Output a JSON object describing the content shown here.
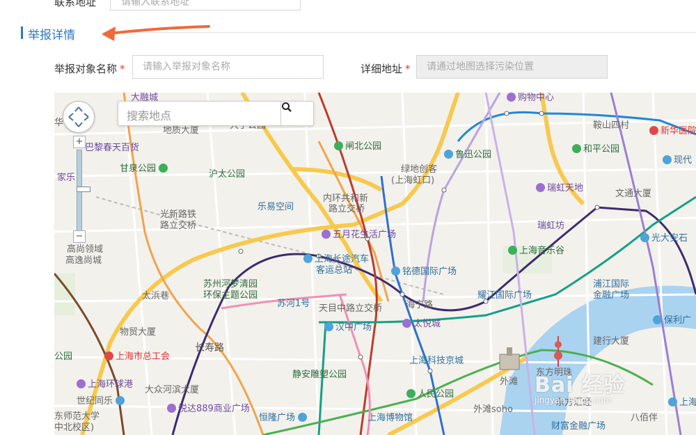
{
  "top_field": {
    "label": "联系地址",
    "placeholder": "请输入联系地址"
  },
  "section": {
    "title": "举报详情"
  },
  "form": {
    "target_name": {
      "label": "举报对象名称",
      "required": "*",
      "placeholder": "请输入举报对象名称"
    },
    "address": {
      "label": "详细地址",
      "required": "*",
      "placeholder": "请通过地图选择污染位置"
    }
  },
  "map": {
    "search_placeholder": "搜索地点",
    "zoom_in": "+",
    "zoom_out": "−",
    "pois": [
      {
        "name": "大融城",
        "kind": "purple"
      },
      {
        "name": "购物中心",
        "kind": "purple"
      },
      {
        "name": "华",
        "kind": "gray"
      },
      {
        "name": "地质大厦",
        "kind": "gray"
      },
      {
        "name": "大宁公园",
        "kind": "gray"
      },
      {
        "name": "鞍山四村",
        "kind": "gray"
      },
      {
        "name": "新华医院",
        "kind": "red"
      },
      {
        "name": "巴黎春天百货",
        "kind": "purple"
      },
      {
        "name": "闸北公园",
        "kind": "green"
      },
      {
        "name": "鲁迅公园",
        "kind": "green"
      },
      {
        "name": "和平公园",
        "kind": "green"
      },
      {
        "name": "甘泉公园",
        "kind": "green"
      },
      {
        "name": "家乐",
        "kind": "purple"
      },
      {
        "name": "沪太公园",
        "kind": "green"
      },
      {
        "name": "绿地创客",
        "kind": "gray"
      },
      {
        "name": "(上海虹口)",
        "kind": "gray"
      },
      {
        "name": "现代",
        "kind": "blue"
      },
      {
        "name": "瑞虹天地",
        "kind": "purple"
      },
      {
        "name": "文通大厦",
        "kind": "gray"
      },
      {
        "name": "乐易空间",
        "kind": "blue"
      },
      {
        "name": "内环共和新",
        "kind": "gray"
      },
      {
        "name": "路立交桥",
        "kind": "gray"
      },
      {
        "name": "光新路铁",
        "kind": "gray"
      },
      {
        "name": "路立交桥",
        "kind": "gray"
      },
      {
        "name": "瑞虹坊",
        "kind": "purple"
      },
      {
        "name": "五月花生活广场",
        "kind": "purple"
      },
      {
        "name": "光大安石",
        "kind": "blue"
      },
      {
        "name": "高尚领域",
        "kind": "gray"
      },
      {
        "name": "高逸尚城",
        "kind": "gray"
      },
      {
        "name": "上海长途汽车",
        "kind": "blue"
      },
      {
        "name": "客运总站",
        "kind": "blue"
      },
      {
        "name": "上海音乐谷",
        "kind": "green"
      },
      {
        "name": "苏州河梦清园",
        "kind": "green"
      },
      {
        "name": "环保主题公园",
        "kind": "green"
      },
      {
        "name": "铭德国际广场",
        "kind": "blue"
      },
      {
        "name": "太浜巷",
        "kind": "gray"
      },
      {
        "name": "浦江国际",
        "kind": "blue"
      },
      {
        "name": "金融广场",
        "kind": "blue"
      },
      {
        "name": "耀江国际广场",
        "kind": "blue"
      },
      {
        "name": "苏河1号",
        "kind": "blue"
      },
      {
        "name": "天目中路立交桥",
        "kind": "gray"
      },
      {
        "name": "海宁路",
        "kind": "gray"
      },
      {
        "name": "汉中广场",
        "kind": "blue"
      },
      {
        "name": "太悦城",
        "kind": "purple"
      },
      {
        "name": "保利广",
        "kind": "blue"
      },
      {
        "name": "物贸大厦",
        "kind": "gray"
      },
      {
        "name": "长寿路",
        "kind": "road"
      },
      {
        "name": "建行大厦",
        "kind": "gray"
      },
      {
        "name": "公园",
        "kind": "green"
      },
      {
        "name": "上海市总工会",
        "kind": "red"
      },
      {
        "name": "上海科技京城",
        "kind": "blue"
      },
      {
        "name": "静安雕塑公园",
        "kind": "green"
      },
      {
        "name": "外滩",
        "kind": "gray"
      },
      {
        "name": "东方明珠",
        "kind": "gray"
      },
      {
        "name": "上海环球港",
        "kind": "purple"
      },
      {
        "name": "大众河滨大厦",
        "kind": "gray"
      },
      {
        "name": "世纪同乐",
        "kind": "gray"
      },
      {
        "name": "人民公园",
        "kind": "green"
      },
      {
        "name": "东方汇经",
        "kind": "gray"
      },
      {
        "name": "东师范大学",
        "kind": "gray"
      },
      {
        "name": "中北校区)",
        "kind": "gray"
      },
      {
        "name": "悦达889商业广场",
        "kind": "purple"
      },
      {
        "name": "恒隆广场",
        "kind": "blue"
      },
      {
        "name": "上海博物馆",
        "kind": "blue"
      },
      {
        "name": "外滩soho",
        "kind": "gray"
      },
      {
        "name": "财富金融广场",
        "kind": "blue"
      },
      {
        "name": "八佰伴",
        "kind": "gray"
      },
      {
        "name": "上海",
        "kind": "blue"
      }
    ]
  },
  "watermark": {
    "main": "Bai 经验",
    "sub": "jingyan.baidu.com"
  }
}
